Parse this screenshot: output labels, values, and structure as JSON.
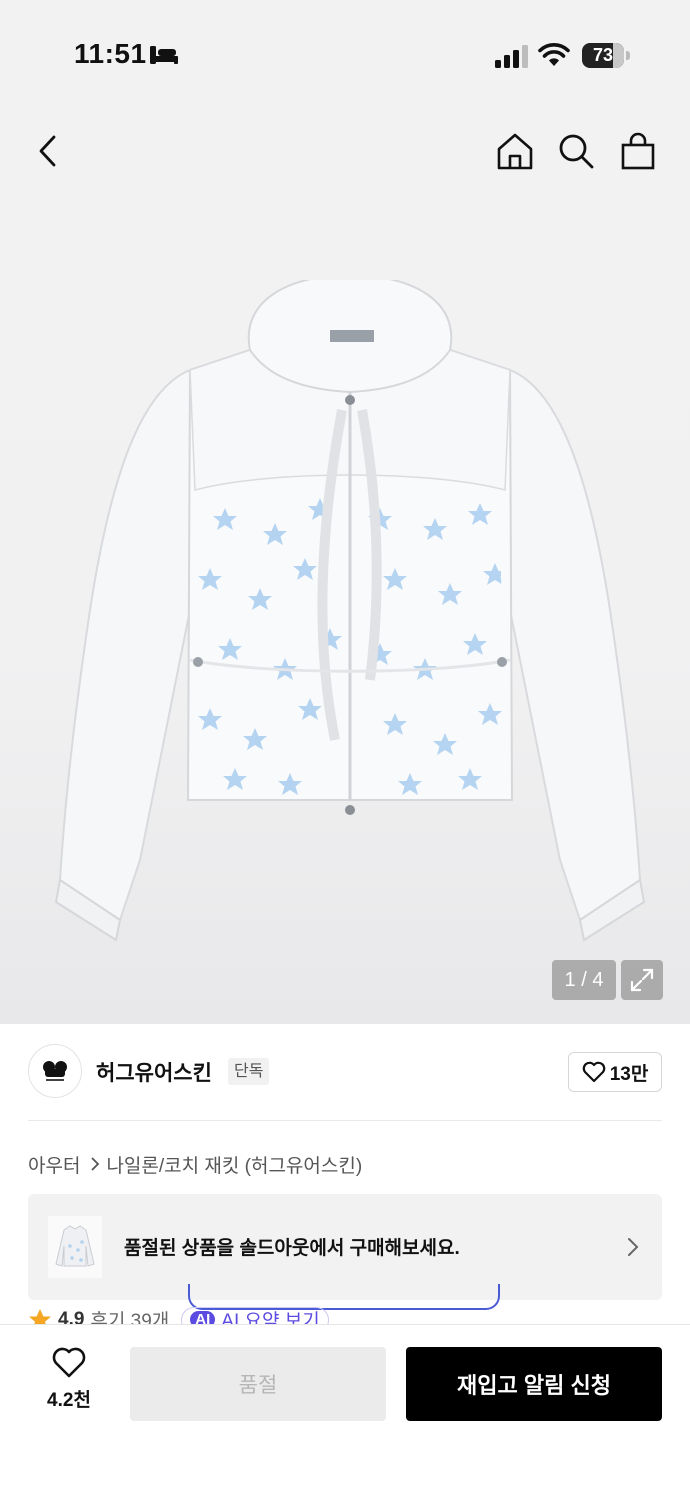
{
  "status_bar": {
    "time": "11:51",
    "battery": "73",
    "battery_level": 0.73,
    "icons": [
      "sleep-focus-icon",
      "cellular-signal-icon",
      "wifi-icon",
      "battery-icon"
    ]
  },
  "header": {
    "icons": [
      "back-arrow-icon",
      "home-icon",
      "search-icon",
      "shopping-bag-icon"
    ]
  },
  "product_image": {
    "counter": "1 / 4",
    "expand_icon": "expand-icon"
  },
  "brand": {
    "name": "허그유어스킨",
    "tag": "단독",
    "likes": "13만"
  },
  "breadcrumb": {
    "category": "아우터",
    "subcategory": "나일론/코치 재킷 (허그유어스킨)"
  },
  "soldout_banner": {
    "text": "품절된 상품을 솔드아웃에서 구매해보세요."
  },
  "rating": {
    "score": "4.9",
    "reviews": "후기 39개",
    "ai_badge": "AI",
    "ai_summary": "AI 요약 보기"
  },
  "bottom_bar": {
    "wish_count": "4.2천",
    "soldout_label": "품절",
    "restock_label": "재입고 알림 신청"
  },
  "colors": {
    "accent_black": "#000000",
    "star": "#f5a623",
    "ai_purple": "#5b4be0",
    "jacket_star_blue": "#a9cdf0"
  }
}
